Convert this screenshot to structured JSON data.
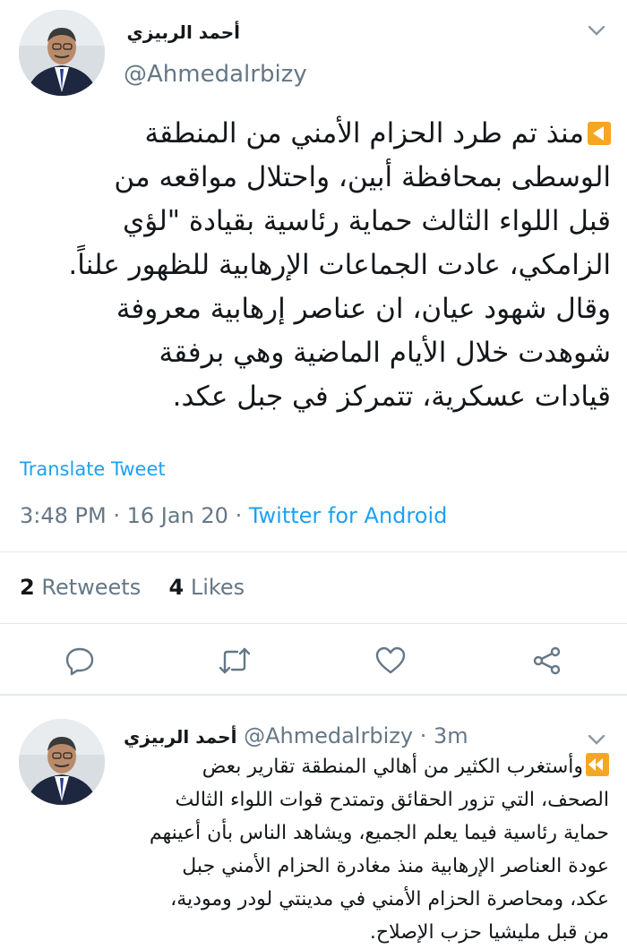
{
  "tweet": {
    "author_name": "أحمد الربيزي",
    "author_handle": "@Ahmedalrbizy",
    "text_lines": [
      "منذ تم طرد الحزام الأمني من المنطقة",
      "الوسطى بمحافظة أبين، واحتلال مواقعه من",
      "قبل اللواء الثالث حماية رئاسية بقيادة \"لؤي",
      "الزامكي، عادت الجماعات الإرهابية للظهور علناً.",
      "وقال شهود عيان، ان عناصر إرهابية معروفة",
      "شوهدت خلال الأيام الماضية وهي برفقة",
      "قيادات عسكرية، تتمركز في جبل عكد."
    ],
    "translate_label": "Translate Tweet",
    "time": "3:48 PM",
    "date": "16 Jan 20",
    "source": "Twitter for Android",
    "retweets_count": "2",
    "retweets_label": "Retweets",
    "likes_count": "4",
    "likes_label": "Likes"
  },
  "reply": {
    "author_name": "أحمد الربيزي",
    "author_handle": "@Ahmedalrbizy",
    "time_ago": "3m",
    "text_lines": [
      "وأستغرب الكثير من أهالي المنطقة تقارير بعض",
      "الصحف، التي تزور الحقائق وتمتدح قوات اللواء الثالث",
      "حماية رئاسية فيما يعلم الجميع، ويشاهد الناس بأن أعينهم",
      "عودة العناصر الإرهابية منذ مغادرة الحزام الأمني جبل",
      "عكد، ومحاصرة الحزام الأمني في مدينتي لودر ومودية،",
      "من قبل مليشيا حزب الإصلاح."
    ]
  },
  "icons": {
    "menu": "chevron-down-icon",
    "reply": "comment-icon",
    "retweet": "retweet-icon",
    "like": "heart-icon",
    "share": "share-icon",
    "play_emoji": "orange-reverse-play-icon",
    "rewind_emoji": "orange-rewind-icon"
  },
  "colors": {
    "link_blue": "#1da1f2",
    "secondary_gray": "#657786",
    "divider": "#e1e8ed",
    "emoji_orange": "#f6a623"
  }
}
